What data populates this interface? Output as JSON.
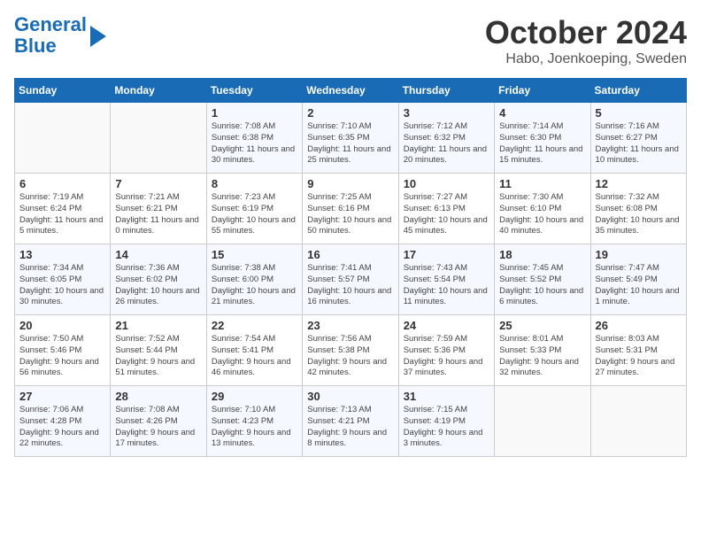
{
  "header": {
    "logo_line1": "General",
    "logo_line2": "Blue",
    "month": "October 2024",
    "location": "Habo, Joenkoeping, Sweden"
  },
  "days_of_week": [
    "Sunday",
    "Monday",
    "Tuesday",
    "Wednesday",
    "Thursday",
    "Friday",
    "Saturday"
  ],
  "weeks": [
    [
      {
        "day": "",
        "detail": ""
      },
      {
        "day": "",
        "detail": ""
      },
      {
        "day": "1",
        "detail": "Sunrise: 7:08 AM\nSunset: 6:38 PM\nDaylight: 11 hours and 30 minutes."
      },
      {
        "day": "2",
        "detail": "Sunrise: 7:10 AM\nSunset: 6:35 PM\nDaylight: 11 hours and 25 minutes."
      },
      {
        "day": "3",
        "detail": "Sunrise: 7:12 AM\nSunset: 6:32 PM\nDaylight: 11 hours and 20 minutes."
      },
      {
        "day": "4",
        "detail": "Sunrise: 7:14 AM\nSunset: 6:30 PM\nDaylight: 11 hours and 15 minutes."
      },
      {
        "day": "5",
        "detail": "Sunrise: 7:16 AM\nSunset: 6:27 PM\nDaylight: 11 hours and 10 minutes."
      }
    ],
    [
      {
        "day": "6",
        "detail": "Sunrise: 7:19 AM\nSunset: 6:24 PM\nDaylight: 11 hours and 5 minutes."
      },
      {
        "day": "7",
        "detail": "Sunrise: 7:21 AM\nSunset: 6:21 PM\nDaylight: 11 hours and 0 minutes."
      },
      {
        "day": "8",
        "detail": "Sunrise: 7:23 AM\nSunset: 6:19 PM\nDaylight: 10 hours and 55 minutes."
      },
      {
        "day": "9",
        "detail": "Sunrise: 7:25 AM\nSunset: 6:16 PM\nDaylight: 10 hours and 50 minutes."
      },
      {
        "day": "10",
        "detail": "Sunrise: 7:27 AM\nSunset: 6:13 PM\nDaylight: 10 hours and 45 minutes."
      },
      {
        "day": "11",
        "detail": "Sunrise: 7:30 AM\nSunset: 6:10 PM\nDaylight: 10 hours and 40 minutes."
      },
      {
        "day": "12",
        "detail": "Sunrise: 7:32 AM\nSunset: 6:08 PM\nDaylight: 10 hours and 35 minutes."
      }
    ],
    [
      {
        "day": "13",
        "detail": "Sunrise: 7:34 AM\nSunset: 6:05 PM\nDaylight: 10 hours and 30 minutes."
      },
      {
        "day": "14",
        "detail": "Sunrise: 7:36 AM\nSunset: 6:02 PM\nDaylight: 10 hours and 26 minutes."
      },
      {
        "day": "15",
        "detail": "Sunrise: 7:38 AM\nSunset: 6:00 PM\nDaylight: 10 hours and 21 minutes."
      },
      {
        "day": "16",
        "detail": "Sunrise: 7:41 AM\nSunset: 5:57 PM\nDaylight: 10 hours and 16 minutes."
      },
      {
        "day": "17",
        "detail": "Sunrise: 7:43 AM\nSunset: 5:54 PM\nDaylight: 10 hours and 11 minutes."
      },
      {
        "day": "18",
        "detail": "Sunrise: 7:45 AM\nSunset: 5:52 PM\nDaylight: 10 hours and 6 minutes."
      },
      {
        "day": "19",
        "detail": "Sunrise: 7:47 AM\nSunset: 5:49 PM\nDaylight: 10 hours and 1 minute."
      }
    ],
    [
      {
        "day": "20",
        "detail": "Sunrise: 7:50 AM\nSunset: 5:46 PM\nDaylight: 9 hours and 56 minutes."
      },
      {
        "day": "21",
        "detail": "Sunrise: 7:52 AM\nSunset: 5:44 PM\nDaylight: 9 hours and 51 minutes."
      },
      {
        "day": "22",
        "detail": "Sunrise: 7:54 AM\nSunset: 5:41 PM\nDaylight: 9 hours and 46 minutes."
      },
      {
        "day": "23",
        "detail": "Sunrise: 7:56 AM\nSunset: 5:38 PM\nDaylight: 9 hours and 42 minutes."
      },
      {
        "day": "24",
        "detail": "Sunrise: 7:59 AM\nSunset: 5:36 PM\nDaylight: 9 hours and 37 minutes."
      },
      {
        "day": "25",
        "detail": "Sunrise: 8:01 AM\nSunset: 5:33 PM\nDaylight: 9 hours and 32 minutes."
      },
      {
        "day": "26",
        "detail": "Sunrise: 8:03 AM\nSunset: 5:31 PM\nDaylight: 9 hours and 27 minutes."
      }
    ],
    [
      {
        "day": "27",
        "detail": "Sunrise: 7:06 AM\nSunset: 4:28 PM\nDaylight: 9 hours and 22 minutes."
      },
      {
        "day": "28",
        "detail": "Sunrise: 7:08 AM\nSunset: 4:26 PM\nDaylight: 9 hours and 17 minutes."
      },
      {
        "day": "29",
        "detail": "Sunrise: 7:10 AM\nSunset: 4:23 PM\nDaylight: 9 hours and 13 minutes."
      },
      {
        "day": "30",
        "detail": "Sunrise: 7:13 AM\nSunset: 4:21 PM\nDaylight: 9 hours and 8 minutes."
      },
      {
        "day": "31",
        "detail": "Sunrise: 7:15 AM\nSunset: 4:19 PM\nDaylight: 9 hours and 3 minutes."
      },
      {
        "day": "",
        "detail": ""
      },
      {
        "day": "",
        "detail": ""
      }
    ]
  ]
}
